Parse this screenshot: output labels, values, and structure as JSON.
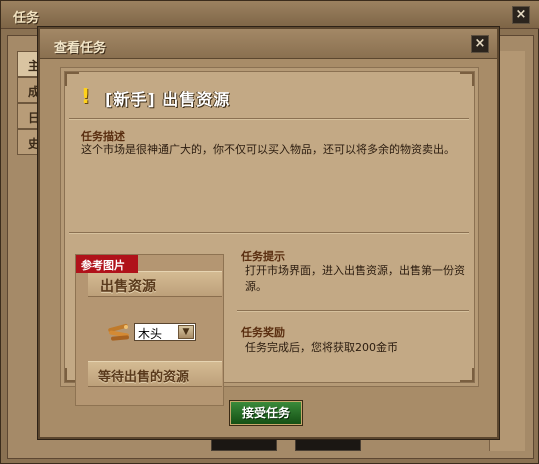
{
  "outer_window": {
    "title": "任务",
    "close_label": "×",
    "tabs": [
      "主",
      "成",
      "日",
      "史"
    ]
  },
  "dialog": {
    "title": "查看任务",
    "close_label": "×",
    "quest_title": "[新手] 出售资源",
    "description_label": "任务描述",
    "description_text": "这个市场是很神通广大的，你不仅可以买入物品，还可以将多余的物资卖出。",
    "reference_image": {
      "tag": "参考图片",
      "top_banner": "出售资源",
      "resource_value": "木头",
      "bottom_banner": "等待出售的资源"
    },
    "hint_label": "任务提示",
    "hint_text": "打开市场界面，进入出售资源，出售第一份资源。",
    "reward_label": "任务奖励",
    "reward_text": "任务完成后，您将获取200金币",
    "accept_button": "接受任务"
  },
  "colors": {
    "accent_red": "#b0121a",
    "accept_green": "#2a7a2a",
    "title_gold": "#ffd21a"
  }
}
